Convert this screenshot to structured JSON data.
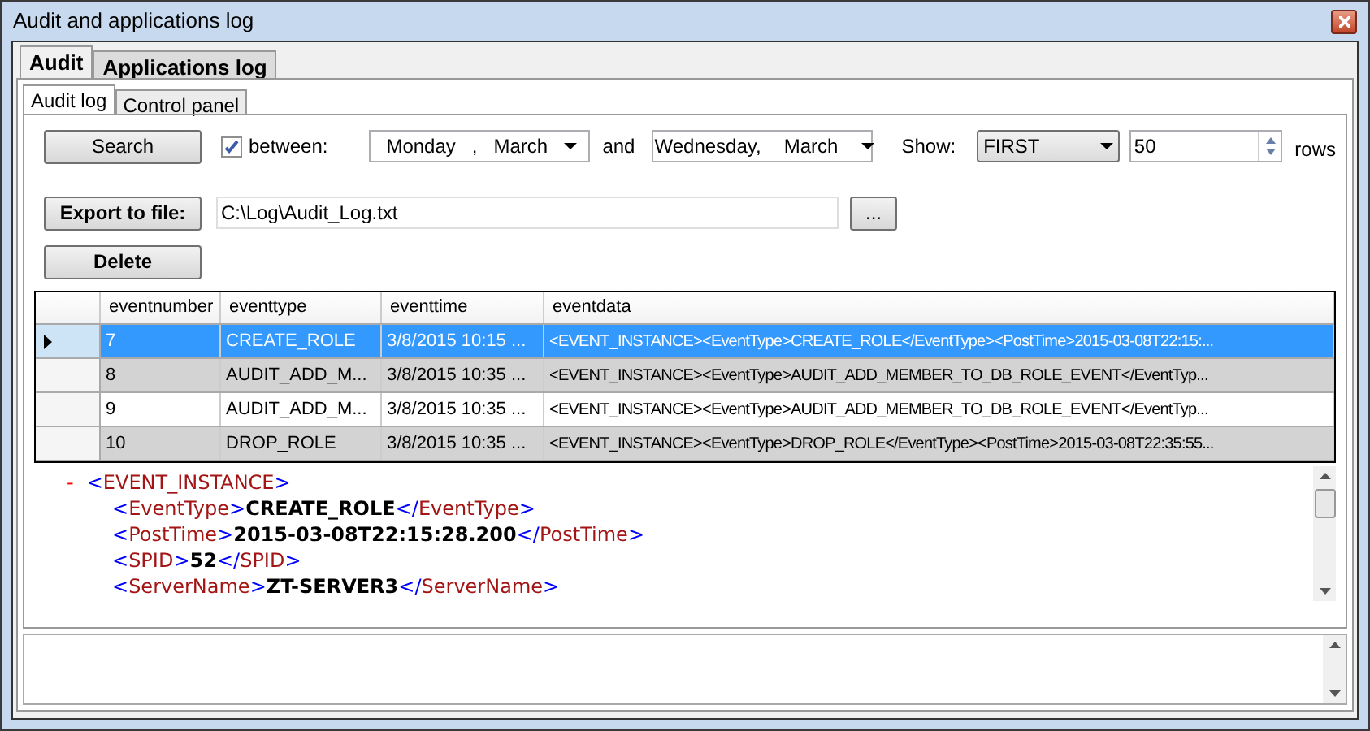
{
  "window": {
    "title": "Audit and applications log"
  },
  "tabs": [
    {
      "label": "Audit",
      "selected": true
    },
    {
      "label": "Applications log",
      "selected": false
    }
  ],
  "subtabs": [
    {
      "label": "Audit log",
      "selected": true
    },
    {
      "label": "Control panel",
      "selected": false
    }
  ],
  "search_button": "Search",
  "between": {
    "label": "between:",
    "checked": true
  },
  "date_from": [
    "Monday",
    ",",
    "March"
  ],
  "and_label": "and",
  "date_to": [
    "Wednesday,",
    "March"
  ],
  "show": {
    "label": "Show:",
    "value": "FIRST"
  },
  "rows_count": {
    "value": "50",
    "label": "rows"
  },
  "export_button": "Export to file:",
  "export_path": "C:\\Log\\Audit_Log.txt",
  "browse_button": "...",
  "delete_button": "Delete",
  "table": {
    "columns": [
      "eventnumber",
      "eventtype",
      "eventtime",
      "eventdata"
    ],
    "rows": [
      {
        "selected": true,
        "cells": [
          "7",
          "CREATE_ROLE",
          "3/8/2015 10:15 ...",
          "<EVENT_INSTANCE><EventType>CREATE_ROLE</EventType><PostTime>2015-03-08T22:15:..."
        ]
      },
      {
        "selected": false,
        "cells": [
          "8",
          "AUDIT_ADD_M...",
          "3/8/2015 10:35 ...",
          "<EVENT_INSTANCE><EventType>AUDIT_ADD_MEMBER_TO_DB_ROLE_EVENT</EventTyp..."
        ]
      },
      {
        "selected": false,
        "cells": [
          "9",
          "AUDIT_ADD_M...",
          "3/8/2015 10:35 ...",
          "<EVENT_INSTANCE><EventType>AUDIT_ADD_MEMBER_TO_DB_ROLE_EVENT</EventTyp..."
        ]
      },
      {
        "selected": false,
        "cells": [
          "10",
          "DROP_ROLE",
          "3/8/2015 10:35 ...",
          "<EVENT_INSTANCE><EventType>DROP_ROLE</EventType><PostTime>2015-03-08T22:35:55..."
        ]
      }
    ]
  },
  "xml_view": {
    "lines": [
      [
        {
          "kind": "marker",
          "text": "-"
        },
        {
          "kind": "bracket",
          "text": "<"
        },
        {
          "kind": "name",
          "text": "EVENT_INSTANCE"
        },
        {
          "kind": "bracket",
          "text": ">"
        }
      ],
      [
        {
          "kind": "bracket",
          "text": "<"
        },
        {
          "kind": "name",
          "text": "EventType"
        },
        {
          "kind": "bracket",
          "text": ">"
        },
        {
          "kind": "value",
          "text": "CREATE_ROLE"
        },
        {
          "kind": "bracket",
          "text": "</"
        },
        {
          "kind": "name",
          "text": "EventType"
        },
        {
          "kind": "bracket",
          "text": ">"
        }
      ],
      [
        {
          "kind": "bracket",
          "text": "<"
        },
        {
          "kind": "name",
          "text": "PostTime"
        },
        {
          "kind": "bracket",
          "text": ">"
        },
        {
          "kind": "value",
          "text": "2015-03-08T22:15:28.200"
        },
        {
          "kind": "bracket",
          "text": "</"
        },
        {
          "kind": "name",
          "text": "PostTime"
        },
        {
          "kind": "bracket",
          "text": ">"
        }
      ],
      [
        {
          "kind": "bracket",
          "text": "<"
        },
        {
          "kind": "name",
          "text": "SPID"
        },
        {
          "kind": "bracket",
          "text": ">"
        },
        {
          "kind": "value",
          "text": "52"
        },
        {
          "kind": "bracket",
          "text": "</"
        },
        {
          "kind": "name",
          "text": "SPID"
        },
        {
          "kind": "bracket",
          "text": ">"
        }
      ],
      [
        {
          "kind": "bracket",
          "text": "<"
        },
        {
          "kind": "name",
          "text": "ServerName"
        },
        {
          "kind": "bracket",
          "text": ">"
        },
        {
          "kind": "value",
          "text": "ZT-SERVER3"
        },
        {
          "kind": "bracket",
          "text": "</"
        },
        {
          "kind": "name",
          "text": "ServerName"
        },
        {
          "kind": "bracket",
          "text": ">"
        }
      ]
    ]
  }
}
